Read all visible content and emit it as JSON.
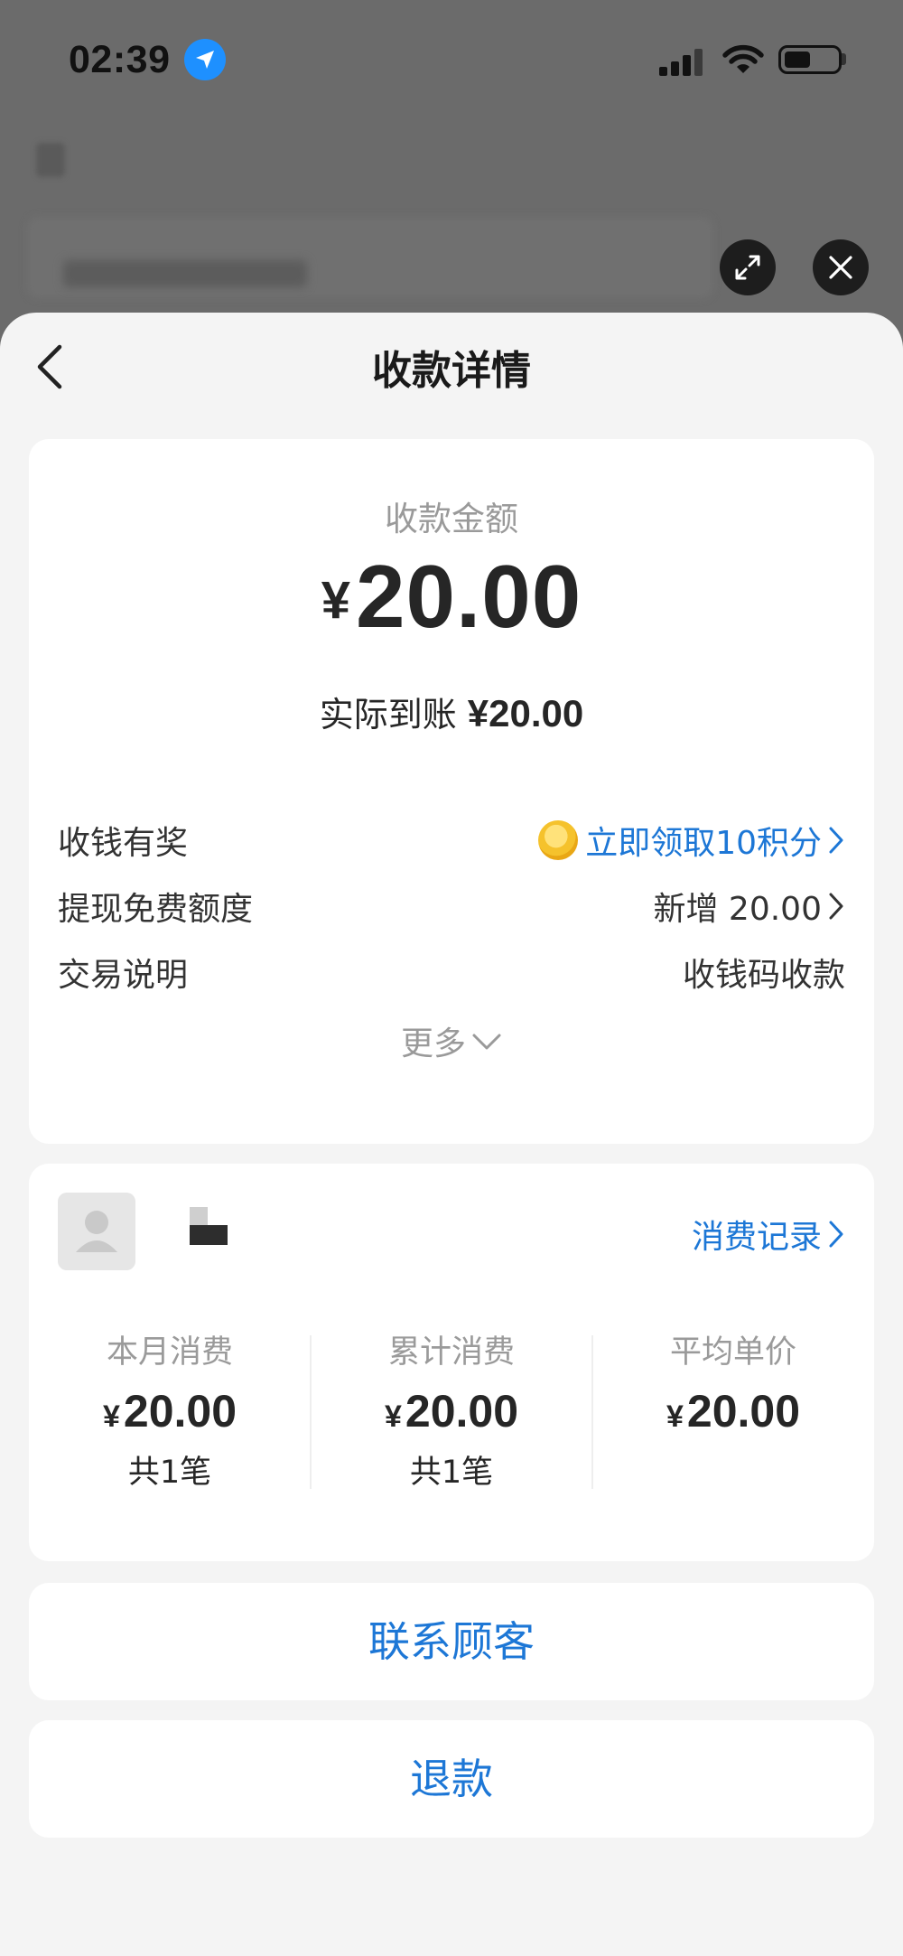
{
  "status_bar": {
    "time": "02:39"
  },
  "header": {
    "title": "收款详情"
  },
  "payment": {
    "amount_label": "收款金额",
    "currency_symbol": "¥",
    "amount": "20.00",
    "actual_label": "实际到账",
    "actual_amount": "¥20.00"
  },
  "details": [
    {
      "label": "收钱有奖",
      "value": "立即领取10积分"
    },
    {
      "label": "提现免费额度",
      "value": "新增 20.00"
    },
    {
      "label": "交易说明",
      "value": "收钱码收款"
    }
  ],
  "more_label": "更多",
  "customer": {
    "records_link": "消费记录",
    "stats": [
      {
        "label": "本月消费",
        "currency": "¥",
        "amount": "20.00",
        "count": "共1笔"
      },
      {
        "label": "累计消费",
        "currency": "¥",
        "amount": "20.00",
        "count": "共1笔"
      },
      {
        "label": "平均单价",
        "currency": "¥",
        "amount": "20.00"
      }
    ]
  },
  "actions": {
    "contact_label": "联系顾客",
    "refund_label": "退款"
  },
  "colors": {
    "accent_blue": "#1d77d6",
    "sheet_background": "#f4f4f4",
    "overlay_gray": "#6b6b6b"
  },
  "icons": [
    "location-arrow-icon",
    "signal-icon",
    "wifi-icon",
    "battery-icon",
    "expand-icon",
    "close-icon",
    "back-chevron-icon",
    "coin-icon",
    "chevron-right-icon",
    "chevron-down-icon",
    "avatar-placeholder-icon"
  ]
}
